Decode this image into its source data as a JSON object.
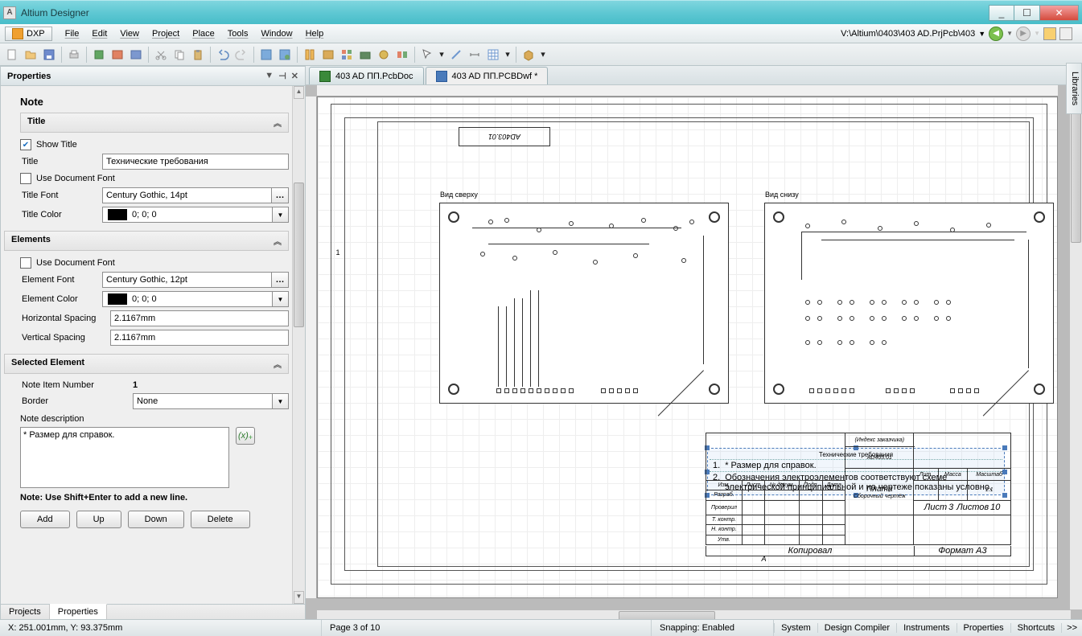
{
  "titlebar": {
    "app_name": "Altium Designer"
  },
  "window_buttons": {
    "min": "_",
    "max": "☐",
    "close": "✕"
  },
  "menubar": {
    "dxp_label": "DXP",
    "items": [
      "File",
      "Edit",
      "View",
      "Project",
      "Place",
      "Tools",
      "Window",
      "Help"
    ],
    "path": "V:\\Altium\\0403\\403 AD.PrjPcb\\403"
  },
  "doc_tabs": [
    {
      "label": "403 AD ПП.PcbDoc",
      "active": false
    },
    {
      "label": "403 AD ПП.PCBDwf *",
      "active": true
    }
  ],
  "side_tab": "Libraries",
  "properties": {
    "panel_title": "Properties",
    "object": "Note",
    "sections": {
      "title": {
        "header": "Title",
        "show_title_label": "Show Title",
        "show_title_checked": true,
        "title_label": "Title",
        "title_value": "Технические требования",
        "use_doc_font_label": "Use Document Font",
        "use_doc_font_checked": false,
        "title_font_label": "Title Font",
        "title_font_value": "Century Gothic, 14pt",
        "title_color_label": "Title Color",
        "title_color_value": "0; 0; 0"
      },
      "elements": {
        "header": "Elements",
        "use_doc_font_label": "Use Document Font",
        "use_doc_font_checked": false,
        "el_font_label": "Element Font",
        "el_font_value": "Century Gothic, 12pt",
        "el_color_label": "Element Color",
        "el_color_value": "0; 0; 0",
        "h_spacing_label": "Horizontal Spacing",
        "h_spacing_value": "2.1167mm",
        "v_spacing_label": "Vertical Spacing",
        "v_spacing_value": "2.1167mm"
      },
      "selected": {
        "header": "Selected Element",
        "item_no_label": "Note Item Number",
        "item_no_value": "1",
        "border_label": "Border",
        "border_value": "None",
        "desc_label": "Note description",
        "desc_value": "* Размер для справок.",
        "hint": "Note: Use Shift+Enter to add a new line.",
        "buttons": {
          "add": "Add",
          "up": "Up",
          "down": "Down",
          "delete": "Delete"
        }
      }
    },
    "bottom_tabs": [
      "Projects",
      "Properties"
    ]
  },
  "drawing": {
    "views": {
      "top": "Вид сверху",
      "bottom": "Вид снизу"
    },
    "top_code": "AD403.01",
    "notes": {
      "title": "Технические требования",
      "items": [
        {
          "n": "1.",
          "t": "* Размер для справок."
        },
        {
          "n": "2.",
          "t": "Обозначения электроэлементов соответствуют схеме электрической принципиальной и на чертеже показаны условно."
        }
      ]
    },
    "titleblock": {
      "index_hdr": "(Индекс заказчика)",
      "code": "AD403.01",
      "name": "Плата",
      "subname": "Сборочный чертёж",
      "cols": {
        "izm": "Изм.",
        "list": "Лист",
        "ndoc": "№ докум.",
        "podp": "Подп.",
        "date": "Дата"
      },
      "rows": [
        "Разраб.",
        "Проверил",
        "Т. контр.",
        "Н. контр.",
        "Утв."
      ],
      "lit": "Лит.",
      "massa": "Масса",
      "masht": "Масштаб",
      "scale": "1:1",
      "sheet_l": "Лист",
      "sheet_n": "3",
      "sheets_l": "Листов",
      "sheets_n": "10",
      "copied": "Копировал",
      "format": "Формат",
      "fmt_val": "А3"
    },
    "zone_bottom": "А",
    "zone_left": "1"
  },
  "statusbar": {
    "coords": "X: 251.001mm, Y: 93.375mm",
    "page": "Page 3 of 10",
    "snap": "Snapping: Enabled",
    "right": [
      "System",
      "Design Compiler",
      "Instruments",
      "Properties",
      "Shortcuts"
    ],
    "more": ">>"
  }
}
